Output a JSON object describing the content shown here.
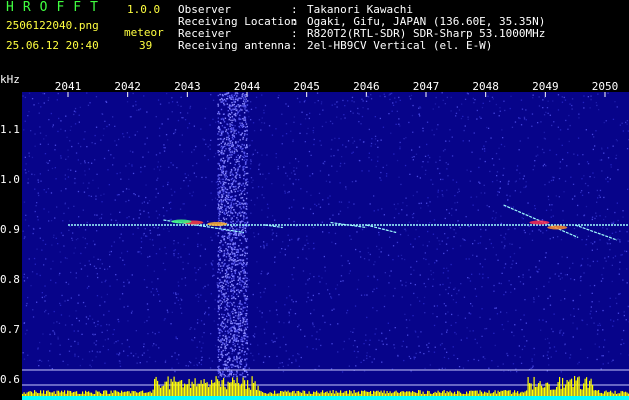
{
  "header": {
    "app_title": "HROFFT",
    "app_version": "1.0.0",
    "filename": "2506122040.png",
    "timestamp": "25.06.12 20:40",
    "meteor_label": "meteor",
    "meteor_count": "39"
  },
  "info": [
    {
      "label": "Observer",
      "value": "Takanori Kawachi"
    },
    {
      "label": "Receiving Location",
      "value": "Ogaki, Gifu, JAPAN (136.60E, 35.35N)"
    },
    {
      "label": "Receiver",
      "value": "R820T2(RTL-SDR) SDR-Sharp 53.1000MHz"
    },
    {
      "label": "Receiving antenna",
      "value": "2el-HB9CV Vertical (el. E-W)"
    }
  ],
  "colors": {
    "background": "#000000",
    "plot_background": "#07048a",
    "title": "#40ff40",
    "meta_text": "#ffff40",
    "signal_line": "#9fffff",
    "bottom_bars": "#ffff00",
    "bottom_strip": "#00ffff"
  },
  "chart_data": {
    "type": "heatmap",
    "x_unit": "minute (HHMM)",
    "y_unit": "kHz",
    "y_unit_label": "kHz",
    "x_ticks": [
      "2041",
      "2042",
      "2043",
      "2044",
      "2045",
      "2046",
      "2047",
      "2048",
      "2049",
      "2050"
    ],
    "y_ticks": [
      "1.1",
      "1.0",
      "0.9",
      "0.8",
      "0.7",
      "0.6"
    ],
    "ylim": [
      0.58,
      1.19
    ],
    "xlim": [
      2040.0,
      2050.2
    ],
    "carrier_freq_khz": 0.91,
    "meteor_count": 39,
    "meteor_traces": [
      {
        "x_start": 2042.6,
        "x_end": 2043.95,
        "f_start": 0.92,
        "f_end": 0.895
      },
      {
        "x_start": 2044.3,
        "x_end": 2044.6,
        "f_start": 0.91,
        "f_end": 0.905
      },
      {
        "x_start": 2045.4,
        "x_end": 2046.0,
        "f_start": 0.915,
        "f_end": 0.905
      },
      {
        "x_start": 2046.0,
        "x_end": 2046.5,
        "f_start": 0.91,
        "f_end": 0.895
      },
      {
        "x_start": 2048.3,
        "x_end": 2049.55,
        "f_start": 0.95,
        "f_end": 0.885
      },
      {
        "x_start": 2049.5,
        "x_end": 2050.2,
        "f_start": 0.91,
        "f_end": 0.88
      }
    ],
    "noise_band_x": [
      2043.5,
      2044.0
    ]
  }
}
